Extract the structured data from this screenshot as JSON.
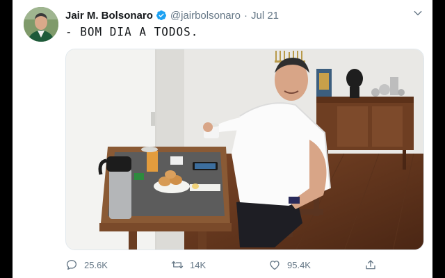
{
  "tweet": {
    "author_name": "Jair M. Bolsonaro",
    "handle": "@jairbolsonaro",
    "separator": "·",
    "date": "Jul 21",
    "text": "- BOM DIA A TODOS."
  },
  "actions": {
    "reply_count": "25.6K",
    "retweet_count": "14K",
    "like_count": "95.4K"
  },
  "icons": [
    "verified-icon",
    "chevron-down-icon",
    "reply-icon",
    "retweet-icon",
    "like-icon",
    "share-icon"
  ],
  "colors": {
    "accent": "#1da1f2",
    "secondary_text": "#657786",
    "primary_text": "#14171a"
  }
}
